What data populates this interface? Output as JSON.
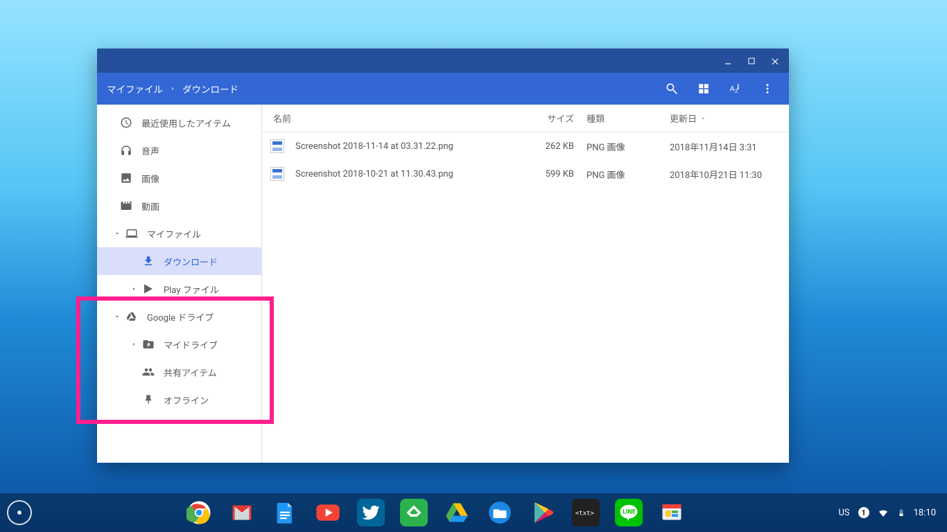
{
  "window": {
    "breadcrumb": [
      "マイファイル",
      "ダウンロード"
    ]
  },
  "sidebar": {
    "recent": "最近使用したアイテム",
    "audio": "音声",
    "images": "画像",
    "videos": "動画",
    "my_files": "マイファイル",
    "downloads": "ダウンロード",
    "play_files": "Play ファイル",
    "google_drive": "Google ドライブ",
    "my_drive": "マイドライブ",
    "shared": "共有アイテム",
    "offline": "オフライン"
  },
  "columns": {
    "name": "名前",
    "size": "サイズ",
    "type": "種類",
    "date": "更新日"
  },
  "files": [
    {
      "name": "Screenshot 2018-11-14 at 03.31.22.png",
      "size": "262 KB",
      "type": "PNG 画像",
      "date": "2018年11月14日 3:31"
    },
    {
      "name": "Screenshot 2018-10-21 at 11.30.43.png",
      "size": "599 KB",
      "type": "PNG 画像",
      "date": "2018年10月21日 11:30"
    }
  ],
  "tray": {
    "ime": "US",
    "notif": "1",
    "time": "18:10"
  }
}
